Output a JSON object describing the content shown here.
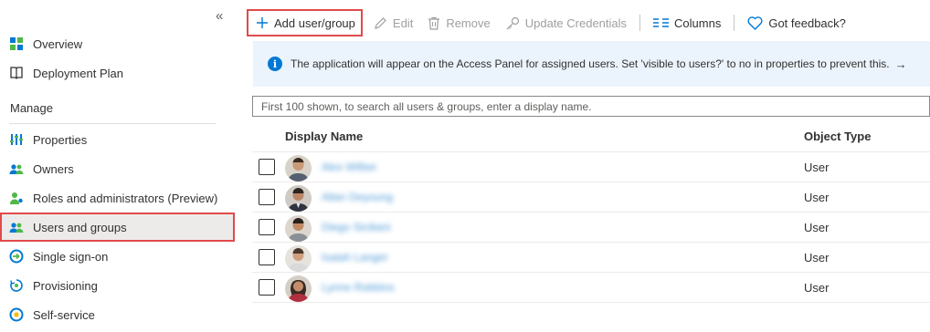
{
  "sidebar": {
    "collapse_glyph": "«",
    "items_top": [
      {
        "label": "Overview",
        "icon": "overview-icon"
      },
      {
        "label": "Deployment Plan",
        "icon": "book-icon"
      }
    ],
    "section_label": "Manage",
    "items_manage": [
      {
        "label": "Properties",
        "icon": "properties-icon"
      },
      {
        "label": "Owners",
        "icon": "owners-icon"
      },
      {
        "label": "Roles and administrators (Preview)",
        "icon": "roles-icon"
      },
      {
        "label": "Users and groups",
        "icon": "users-groups-icon",
        "selected": true
      },
      {
        "label": "Single sign-on",
        "icon": "sso-icon"
      },
      {
        "label": "Provisioning",
        "icon": "provisioning-icon"
      },
      {
        "label": "Self-service",
        "icon": "self-service-icon"
      }
    ]
  },
  "toolbar": {
    "add_label": "Add user/group",
    "edit_label": "Edit",
    "remove_label": "Remove",
    "update_credentials_label": "Update Credentials",
    "columns_label": "Columns",
    "feedback_label": "Got feedback?"
  },
  "banner": {
    "text": "The application will appear on the Access Panel for assigned users. Set 'visible to users?' to no in properties to prevent this.",
    "arrow": "→"
  },
  "search": {
    "placeholder": "First 100 shown, to search all users & groups, enter a display name."
  },
  "table": {
    "columns": [
      "Display Name",
      "Object Type"
    ],
    "rows": [
      {
        "display_name": "Alex Wilber",
        "object_type": "User"
      },
      {
        "display_name": "Allan Deyoung",
        "object_type": "User"
      },
      {
        "display_name": "Diego Siciliani",
        "object_type": "User"
      },
      {
        "display_name": "Isaiah Langer",
        "object_type": "User"
      },
      {
        "display_name": "Lynne Robbins",
        "object_type": "User"
      }
    ]
  },
  "colors": {
    "accent": "#0078d4",
    "highlight_border": "#e04a4a",
    "banner_bg": "#ebf3fc",
    "selected_bg": "#edebe9"
  }
}
